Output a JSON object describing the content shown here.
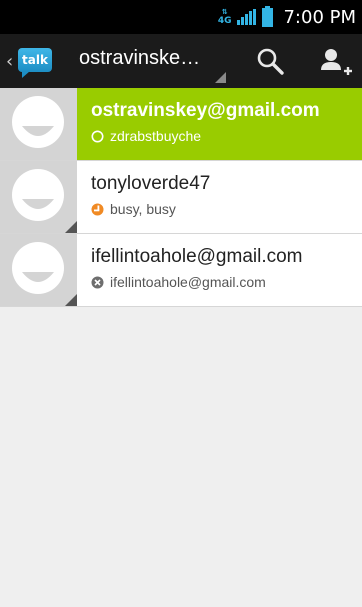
{
  "status_bar": {
    "network": "4G",
    "time": "7:00 PM"
  },
  "action_bar": {
    "logo_label": "talk",
    "account_name": "ostravinske…"
  },
  "contacts": [
    {
      "name": "ostravinskey@gmail.com",
      "status": "zdrabstbuyche",
      "presence": "available-outline",
      "selected": true
    },
    {
      "name": "tonyloverde47",
      "status": "busy, busy",
      "presence": "busy",
      "selected": false
    },
    {
      "name": "ifellintoahole@gmail.com",
      "status": "ifellintoahole@gmail.com",
      "presence": "offline",
      "selected": false
    }
  ],
  "colors": {
    "accent_selected": "#99cc00",
    "busy": "#f08a24",
    "offline": "#6e6e6e",
    "status_bar_icons": "#33b5e5"
  }
}
